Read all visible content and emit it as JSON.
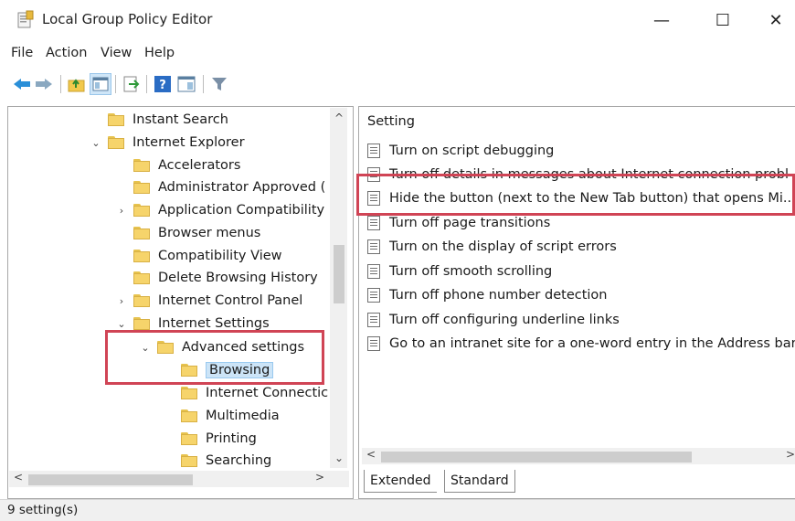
{
  "window": {
    "title": "Local Group Policy Editor",
    "controls": [
      "—",
      "☐",
      "✕"
    ]
  },
  "menu": [
    "File",
    "Action",
    "View",
    "Help"
  ],
  "toolbar": [
    "back-icon",
    "forward-icon",
    "up-folder-icon",
    "show-hide-tree-icon",
    "export-list-icon",
    "help-icon",
    "properties-icon",
    "filter-icon"
  ],
  "tree": {
    "items": [
      {
        "label": "Instant Search",
        "chevron": ""
      },
      {
        "label": "Internet Explorer",
        "chevron": "⌄"
      },
      {
        "label": "Accelerators",
        "chevron": ""
      },
      {
        "label": "Administrator Approved (",
        "chevron": ""
      },
      {
        "label": "Application Compatibility",
        "chevron": "›"
      },
      {
        "label": "Browser menus",
        "chevron": ""
      },
      {
        "label": "Compatibility View",
        "chevron": ""
      },
      {
        "label": "Delete Browsing History",
        "chevron": ""
      },
      {
        "label": "Internet Control Panel",
        "chevron": "›"
      },
      {
        "label": "Internet Settings",
        "chevron": "⌄"
      },
      {
        "label": "Advanced settings",
        "chevron": "⌄"
      },
      {
        "label": "Browsing",
        "chevron": ""
      },
      {
        "label": "Internet Connectic",
        "chevron": ""
      },
      {
        "label": "Multimedia",
        "chevron": ""
      },
      {
        "label": "Printing",
        "chevron": ""
      },
      {
        "label": "Searching",
        "chevron": ""
      }
    ],
    "scroll_up": "^",
    "scroll_down": "⌄",
    "scroll_left": "<",
    "scroll_right": ">"
  },
  "settings": {
    "column_header": "Setting",
    "rows": [
      "Turn on script debugging",
      "Turn off details in messages about Internet connection probl",
      "Hide the button (next to the New Tab button) that opens Mi...",
      "Turn off page transitions",
      "Turn on the display of script errors",
      "Turn off smooth scrolling",
      "Turn off phone number detection",
      "Turn off configuring underline links",
      "Go to an intranet site for a one-word entry in the Address bar"
    ],
    "scroll_left": "<",
    "scroll_right": ">"
  },
  "tabs": [
    "Extended",
    "Standard"
  ],
  "status": "9 setting(s)",
  "colors": {
    "highlight": "#d04455",
    "selection": "#cce4f7"
  }
}
